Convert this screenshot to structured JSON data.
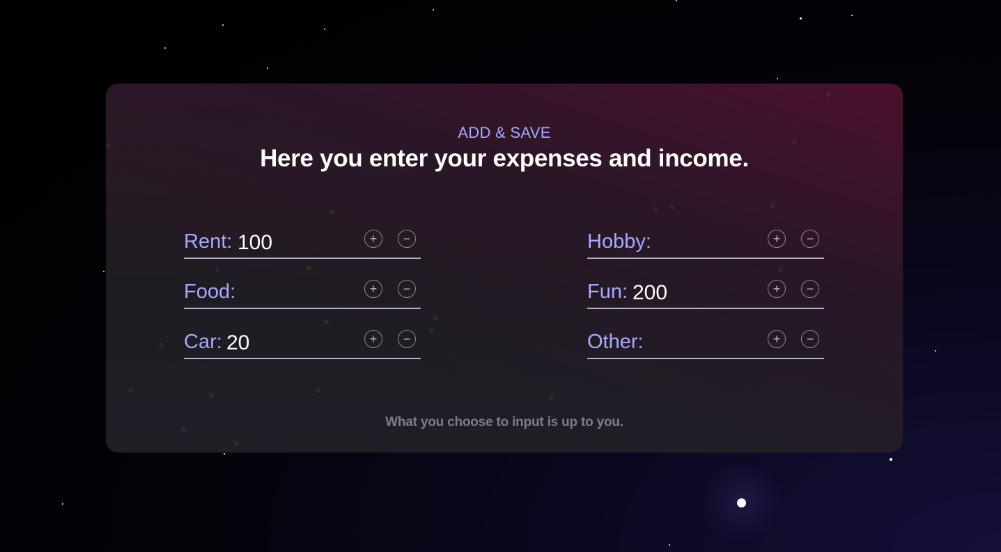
{
  "section": {
    "eyebrow": "ADD & SAVE",
    "headline": "Here you enter your expenses and income.",
    "footer_note": "What you choose to input is up to you."
  },
  "fields": {
    "rent": {
      "label": "Rent:",
      "value": "100"
    },
    "food": {
      "label": "Food:",
      "value": ""
    },
    "car": {
      "label": "Car:",
      "value": "20"
    },
    "hobby": {
      "label": "Hobby:",
      "value": ""
    },
    "fun": {
      "label": "Fun:",
      "value": "200"
    },
    "other": {
      "label": "Other:",
      "value": ""
    }
  },
  "buttons": {
    "plus_glyph": "+",
    "minus_glyph": "−"
  },
  "icons": {
    "increase": "plus-circle-icon",
    "decrease": "minus-circle-icon"
  },
  "colors": {
    "accent_label": "#a9a9ff",
    "value_text": "#ffffff",
    "underline": "#b6b0c2",
    "footer_text": "#7d7d85"
  }
}
